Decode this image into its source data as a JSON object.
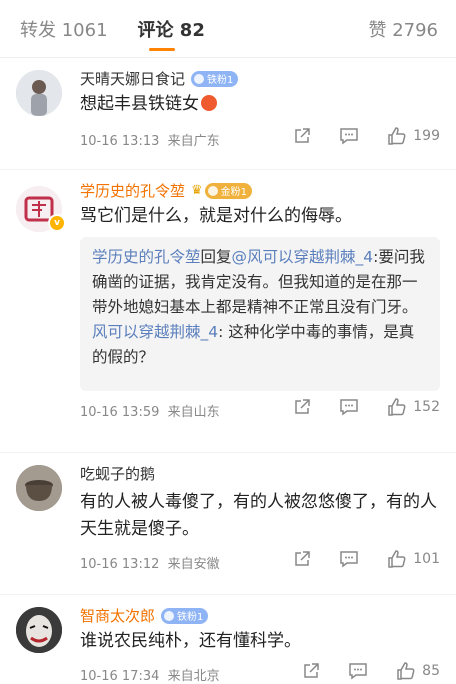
{
  "tabs": {
    "repost": "转发 1061",
    "comments": "评论 82",
    "likes": "赞 2796"
  },
  "accent": "#ff8200",
  "link_color": "#5b7fbd",
  "comments": [
    {
      "user": "天晴天娜日食记",
      "badge": "铁粉1",
      "text": "想起丰县铁链女",
      "time": "10-16 13:13",
      "location": "来自广东",
      "likes": "199"
    },
    {
      "user": "学历史的孔令堃",
      "badge": "金粉1",
      "text": "骂它们是什么，就是对什么的侮辱。",
      "reply": {
        "line1_user": "学历史的孔令堃",
        "line1_mid": "回复",
        "line1_at": "@风可以穿越荆棘_4",
        "line1_text": ":要问我确凿的证据，我肯定没有。但我知道的是在那一带外地媳妇基本上都是精神不正常且没有门牙。",
        "line2_user": "风可以穿越荆棘_4",
        "line2_text": ": 这种化学中毒的事情，是真的假的？"
      },
      "time": "10-16 13:59",
      "location": "来自山东",
      "likes": "152"
    },
    {
      "user": "吃蚬子的鹅",
      "text": "有的人被人毒傻了，有的人被忽悠傻了，有的人天生就是傻子。",
      "time": "10-16 13:12",
      "location": "来自安徽",
      "likes": "101"
    },
    {
      "user": "智商太次郎",
      "badge": "铁粉1",
      "text": "谁说农民纯朴，还有懂科学。",
      "time": "10-16 17:34",
      "location": "来自北京",
      "likes": "85"
    }
  ]
}
